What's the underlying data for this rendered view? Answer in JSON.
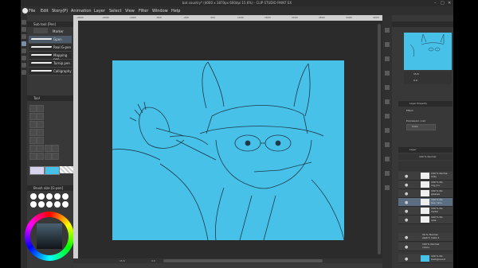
{
  "window": {
    "title": "bat country* (4000 x 3870px 600dpi 15.6%)  - CLIP STUDIO PAINT EX"
  },
  "menu": [
    "File",
    "Edit",
    "Story(P)",
    "Animation",
    "Layer",
    "Select",
    "View",
    "Filter",
    "Window",
    "Help"
  ],
  "sub_tool": {
    "header": "Sub tool [Pen]",
    "tabs": [
      "Marker"
    ],
    "brushes": [
      "Gpen",
      "Real G-pen",
      "Mapping pen",
      "Turnip pen",
      "Calligraphy"
    ]
  },
  "tool_property": {
    "header": "Tool"
  },
  "brush_size": {
    "header": "Brush size [G-pen]"
  },
  "ruler_ticks": [
    "-2600",
    "-2400",
    "-2200",
    "-2000",
    "-1800",
    "-1600",
    "-1400",
    "-1200",
    "-1000",
    "-800",
    "-600",
    "-400",
    "-200",
    "0",
    "200",
    "400",
    "600",
    "800",
    "1000",
    "1200",
    "1400",
    "1600",
    "1800",
    "2000",
    "2200",
    "2400",
    "2600",
    "2800",
    "3000",
    "3200",
    "3400",
    "3600",
    "3800",
    "4000",
    "4200",
    "4400",
    "4600"
  ],
  "status": {
    "zoom": "15.6",
    "angle": "0.0"
  },
  "navigator": {
    "zoom": "15.6",
    "angle": "0.0"
  },
  "layer_property": {
    "header": "Layer Property",
    "effect": "Effect",
    "expression": "Expression color",
    "color_value": "Color"
  },
  "layer_panel": {
    "header": "Layer",
    "blend": "100 % Normal",
    "layers": [
      {
        "name": "100 % Norma\nlinks"
      },
      {
        "name": "100 % No\nrug_ins"
      },
      {
        "name": "100 % No\nglasses"
      },
      {
        "name": "100 % No\nbea  lens"
      },
      {
        "name": "100 % No\nmetal"
      },
      {
        "name": "100 % No\nrelia"
      },
      {
        "name": "30 % Normal\nsketch meta 2"
      },
      {
        "name": "100 % Normal\ncolors"
      },
      {
        "name": "100 % No\nbackground"
      }
    ]
  }
}
